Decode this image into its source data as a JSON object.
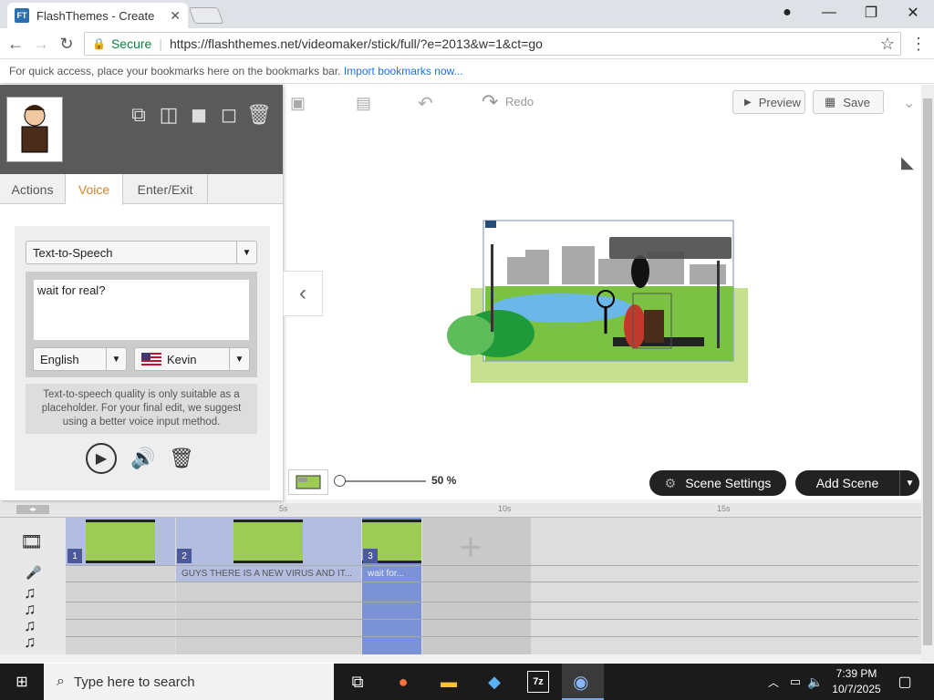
{
  "browser": {
    "tab_title": "FlashThemes - Create",
    "favicon_text": "FT",
    "secure_label": "Secure",
    "url": "https://flashthemes.net/videomaker/stick/full/?e=2013&w=1&ct=go",
    "bookmarks_hint": "For quick access, place your bookmarks here on the bookmarks bar.",
    "bookmarks_link": "Import bookmarks now..."
  },
  "toolbar": {
    "redo_label": "Redo",
    "preview_label": "Preview",
    "save_label": "Save"
  },
  "panel": {
    "tabs": [
      {
        "label": "Actions"
      },
      {
        "label": "Voice"
      },
      {
        "label": "Enter/Exit"
      }
    ],
    "active_tab": "Voice",
    "voice_mode": "Text-to-Speech",
    "tts_text": "wait for real?",
    "language": "English",
    "voice_name": "Kevin",
    "note": "Text-to-speech quality is only suitable as a placeholder. For your final edit, we suggest using a better voice input method."
  },
  "stage": {
    "zoom_label": "50 %",
    "scene_settings_label": "Scene Settings",
    "add_scene_label": "Add Scene"
  },
  "timeline": {
    "ruler": [
      "5s",
      "10s",
      "15s"
    ],
    "scenes": [
      {
        "number": "1",
        "caption": ""
      },
      {
        "number": "2",
        "caption": "GUYS THERE IS A NEW VIRUS AND IT..."
      },
      {
        "number": "3",
        "caption": "wait for..."
      }
    ]
  },
  "taskbar": {
    "search_placeholder": "Type here to search",
    "time": "7:39 PM",
    "date": "10/7/2025"
  },
  "colors": {
    "active_tab": "#d9822b",
    "scene_block": "#b3bde0",
    "selected_scene": "#7b93d6",
    "grass": "#7cc242"
  }
}
